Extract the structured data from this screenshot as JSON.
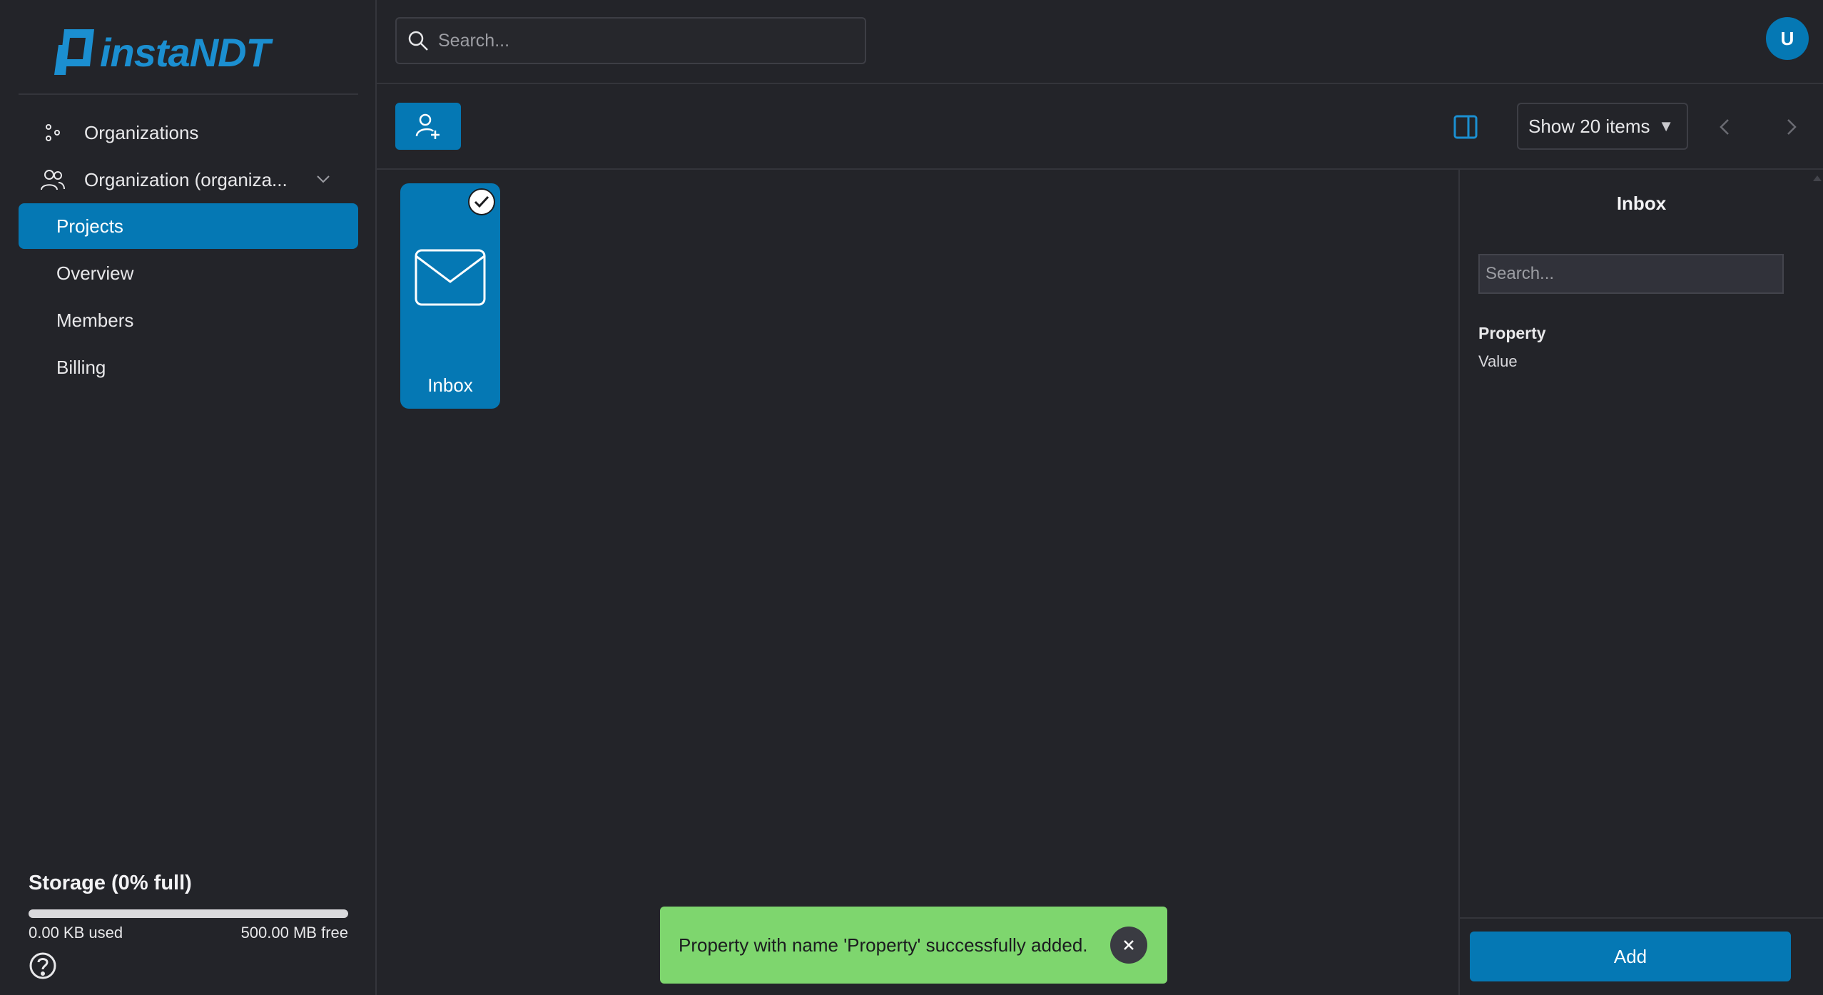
{
  "app": {
    "logo_text": "instaNDT",
    "brand_color": "#0578b4",
    "accent_color": "#1b8fd1"
  },
  "sidebar": {
    "items": [
      {
        "label": "Organizations",
        "icon": "organizations-icon"
      },
      {
        "label": "Organization (organiza...",
        "icon": "users-icon",
        "expandable": true
      },
      {
        "label": "Projects",
        "active": true
      },
      {
        "label": "Overview"
      },
      {
        "label": "Members"
      },
      {
        "label": "Billing"
      }
    ],
    "storage": {
      "title": "Storage (0% full)",
      "used": "0.00 KB used",
      "free": "500.00 MB free",
      "fraction_full": 0
    }
  },
  "header": {
    "search_placeholder": "Search...",
    "avatar_initial": "U"
  },
  "toolbar": {
    "page_size_label": "Show 20 items"
  },
  "grid": {
    "items": [
      {
        "label": "Inbox",
        "icon": "mail-icon",
        "selected": true
      }
    ]
  },
  "panel": {
    "title": "Inbox",
    "search_placeholder": "Search...",
    "properties": [
      {
        "name": "Property",
        "value": "Value"
      }
    ],
    "add_label": "Add"
  },
  "toast": {
    "message": "Property with name 'Property' successfully added.",
    "color": "#7ed66e"
  }
}
